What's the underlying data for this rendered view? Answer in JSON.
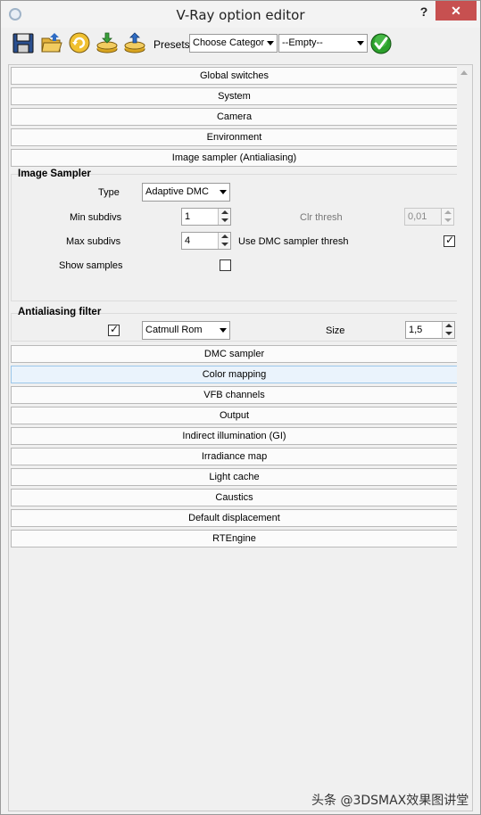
{
  "window": {
    "title": "V-Ray option editor",
    "help_label": "?",
    "close_label": "✕"
  },
  "toolbar": {
    "buttons": [
      {
        "icon": "save-icon"
      },
      {
        "icon": "open-folder-icon"
      },
      {
        "icon": "refresh-icon"
      },
      {
        "icon": "load-preset-icon"
      },
      {
        "icon": "save-preset-icon"
      }
    ],
    "presets_label": "Presets:",
    "presets_value": "Choose Categor",
    "slot_value": "--Empty--",
    "apply_icon": "green-check-icon"
  },
  "rollouts_top": [
    {
      "label": "Global switches"
    },
    {
      "label": "System"
    },
    {
      "label": "Camera"
    },
    {
      "label": "Environment"
    },
    {
      "label": "Image sampler (Antialiasing)"
    }
  ],
  "image_sampler": {
    "title": "Image Sampler",
    "type_label": "Type",
    "type_value": "Adaptive DMC",
    "min_subdivs_label": "Min subdivs",
    "min_subdivs_value": "1",
    "max_subdivs_label": "Max subdivs",
    "max_subdivs_value": "4",
    "clr_thresh_label": "Clr thresh",
    "clr_thresh_value": "0,01",
    "use_dmc_label": "Use DMC sampler thresh",
    "use_dmc_checked": true,
    "show_samples_label": "Show samples",
    "show_samples_checked": false
  },
  "aa_filter": {
    "title": "Antialiasing filter",
    "enabled": true,
    "filter_value": "Catmull Rom",
    "size_label": "Size",
    "size_value": "1,5"
  },
  "rollouts_bottom": [
    {
      "label": "DMC sampler"
    },
    {
      "label": "Color mapping"
    },
    {
      "label": "VFB channels"
    },
    {
      "label": "Output"
    },
    {
      "label": "Indirect illumination (GI)"
    },
    {
      "label": "Irradiance map"
    },
    {
      "label": "Light cache"
    },
    {
      "label": "Caustics"
    },
    {
      "label": "Default displacement"
    },
    {
      "label": "RTEngine"
    }
  ],
  "watermark": "头条 @3DSMAX效果图讲堂"
}
